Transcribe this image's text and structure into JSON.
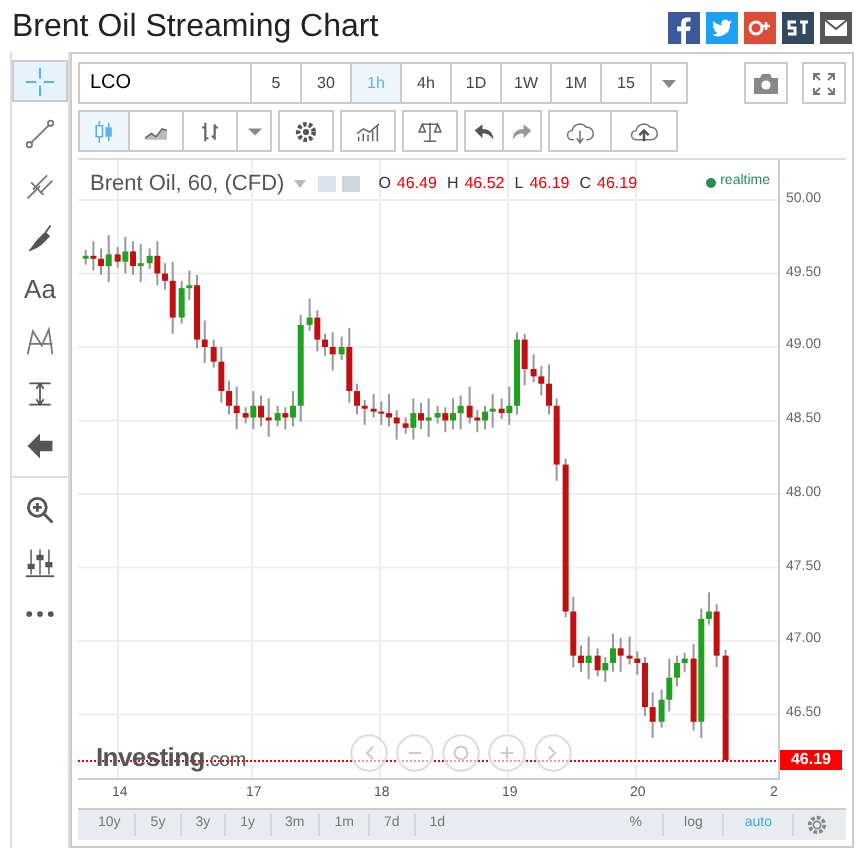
{
  "title": "Brent Oil Streaming Chart",
  "left_tools": [
    {
      "kind": "crosshair",
      "selected": true
    },
    {
      "kind": "line",
      "selected": false
    },
    {
      "kind": "fork",
      "selected": false
    },
    {
      "kind": "brush",
      "selected": false
    },
    {
      "kind": "text",
      "label": "Aa",
      "selected": false
    },
    {
      "kind": "pattern",
      "selected": false
    },
    {
      "kind": "measure",
      "selected": false
    },
    {
      "kind": "back",
      "selected": false
    },
    {
      "kind": "zoom",
      "selected": false
    },
    {
      "kind": "adjust",
      "selected": false
    },
    {
      "kind": "more",
      "selected": false
    }
  ],
  "symbol": "LCO",
  "intervals": [
    {
      "label": "5",
      "selected": false
    },
    {
      "label": "30",
      "selected": false
    },
    {
      "label": "1h",
      "selected": true
    },
    {
      "label": "4h",
      "selected": false
    },
    {
      "label": "1D",
      "selected": false
    },
    {
      "label": "1W",
      "selected": false
    },
    {
      "label": "1M",
      "selected": false
    },
    {
      "label": "15",
      "selected": false
    }
  ],
  "chart_tools": [
    {
      "kind": "candles",
      "selected": true
    },
    {
      "kind": "line",
      "selected": false
    },
    {
      "kind": "bars",
      "selected": false
    },
    {
      "kind": "caret",
      "selected": false
    },
    {
      "kind": "settings",
      "selected": false
    },
    {
      "kind": "indicators",
      "selected": false
    },
    {
      "kind": "compare",
      "selected": false
    },
    {
      "kind": "undo",
      "selected": false
    },
    {
      "kind": "redo",
      "selected": false
    },
    {
      "kind": "download",
      "selected": false
    },
    {
      "kind": "upload",
      "selected": false
    }
  ],
  "legend": {
    "name": "Brent Oil, 60, (CFD)",
    "values": [
      {
        "key": "O",
        "value": "46.49"
      },
      {
        "key": "H",
        "value": "46.52"
      },
      {
        "key": "L",
        "value": "46.19"
      },
      {
        "key": "C",
        "value": "46.19"
      }
    ],
    "status": "realtime"
  },
  "chart_data": {
    "type": "candlestick",
    "x": [
      15.7,
      15.76,
      15.82,
      15.88,
      15.95,
      16.01,
      16.07,
      16.13,
      16.2,
      16.26,
      16.32,
      16.38,
      16.45,
      16.51,
      16.57,
      16.63,
      16.7,
      16.76,
      16.82,
      16.88,
      16.95,
      17.01,
      17.07,
      17.13,
      17.2,
      17.26,
      17.32,
      17.38,
      17.45,
      17.51,
      17.57,
      17.63,
      17.7,
      17.76,
      17.82,
      17.88,
      17.95,
      18.01,
      18.07,
      18.13,
      18.2,
      18.26,
      18.32,
      18.38,
      18.45,
      18.51,
      18.57,
      18.63,
      18.7,
      18.76,
      18.82,
      18.88,
      18.95,
      19.01,
      19.07,
      19.13,
      19.2,
      19.26,
      19.32,
      19.38,
      19.45,
      19.51,
      19.57,
      19.63,
      19.7,
      19.76,
      19.82,
      19.88,
      19.95,
      20.01,
      20.07,
      20.13,
      20.2,
      20.26,
      20.32,
      20.38,
      20.45,
      20.51,
      20.57,
      20.63,
      20.7
    ],
    "ohlc": [
      [
        49.6,
        49.66,
        49.56,
        49.62
      ],
      [
        49.62,
        49.72,
        49.52,
        49.6
      ],
      [
        49.6,
        49.67,
        49.49,
        49.55
      ],
      [
        49.55,
        49.76,
        49.44,
        49.63
      ],
      [
        49.63,
        49.68,
        49.54,
        49.58
      ],
      [
        49.58,
        49.75,
        49.5,
        49.65
      ],
      [
        49.65,
        49.72,
        49.49,
        49.55
      ],
      [
        49.55,
        49.7,
        49.44,
        49.57
      ],
      [
        49.57,
        49.67,
        49.53,
        49.62
      ],
      [
        49.62,
        49.72,
        49.42,
        49.5
      ],
      [
        49.5,
        49.57,
        49.39,
        49.45
      ],
      [
        49.45,
        49.58,
        49.09,
        49.2
      ],
      [
        49.2,
        49.45,
        49.16,
        49.4
      ],
      [
        49.4,
        49.52,
        49.32,
        49.42
      ],
      [
        49.42,
        49.49,
        48.99,
        49.05
      ],
      [
        49.05,
        49.18,
        48.89,
        49.0
      ],
      [
        49.0,
        49.05,
        48.86,
        48.9
      ],
      [
        48.9,
        49.0,
        48.62,
        48.7
      ],
      [
        48.7,
        48.77,
        48.54,
        48.6
      ],
      [
        48.6,
        48.73,
        48.44,
        48.55
      ],
      [
        48.55,
        48.59,
        48.48,
        48.52
      ],
      [
        48.52,
        48.7,
        48.44,
        48.6
      ],
      [
        48.6,
        48.67,
        48.46,
        48.52
      ],
      [
        48.52,
        48.65,
        48.39,
        48.5
      ],
      [
        48.5,
        48.6,
        48.46,
        48.55
      ],
      [
        48.55,
        48.59,
        48.44,
        48.52
      ],
      [
        48.52,
        48.7,
        48.46,
        48.6
      ],
      [
        48.6,
        49.22,
        48.49,
        49.15
      ],
      [
        49.15,
        49.33,
        49.11,
        49.2
      ],
      [
        49.2,
        49.25,
        48.97,
        49.05
      ],
      [
        49.05,
        49.09,
        48.94,
        49.0
      ],
      [
        49.0,
        49.1,
        48.84,
        48.95
      ],
      [
        48.95,
        49.07,
        48.91,
        49.0
      ],
      [
        49.0,
        49.13,
        48.62,
        48.7
      ],
      [
        48.7,
        48.75,
        48.54,
        48.6
      ],
      [
        48.6,
        48.64,
        48.47,
        48.58
      ],
      [
        48.58,
        48.68,
        48.52,
        48.56
      ],
      [
        48.56,
        48.63,
        48.47,
        48.55
      ],
      [
        48.55,
        48.68,
        48.46,
        48.52
      ],
      [
        48.52,
        48.57,
        48.37,
        48.48
      ],
      [
        48.48,
        48.52,
        48.41,
        48.45
      ],
      [
        48.45,
        48.65,
        48.37,
        48.55
      ],
      [
        48.55,
        48.62,
        48.44,
        48.5
      ],
      [
        48.5,
        48.65,
        48.39,
        48.52
      ],
      [
        48.52,
        48.6,
        48.48,
        48.55
      ],
      [
        48.55,
        48.59,
        48.42,
        48.5
      ],
      [
        48.5,
        48.65,
        48.44,
        48.55
      ],
      [
        48.55,
        48.67,
        48.44,
        48.6
      ],
      [
        48.6,
        48.73,
        48.48,
        48.52
      ],
      [
        48.52,
        48.57,
        48.42,
        48.5
      ],
      [
        48.5,
        48.6,
        48.44,
        48.56
      ],
      [
        48.56,
        48.68,
        48.45,
        48.58
      ],
      [
        48.58,
        48.65,
        48.51,
        48.55
      ],
      [
        48.55,
        48.73,
        48.47,
        48.6
      ],
      [
        48.6,
        49.1,
        48.54,
        49.05
      ],
      [
        49.05,
        49.09,
        48.74,
        48.85
      ],
      [
        48.85,
        48.95,
        48.76,
        48.8
      ],
      [
        48.8,
        48.87,
        48.67,
        48.75
      ],
      [
        48.75,
        48.88,
        48.54,
        48.6
      ],
      [
        48.6,
        48.65,
        48.09,
        48.2
      ],
      [
        48.2,
        48.24,
        47.16,
        47.2
      ],
      [
        47.2,
        47.3,
        46.82,
        46.9
      ],
      [
        46.9,
        46.97,
        46.79,
        46.85
      ],
      [
        46.85,
        47.03,
        46.74,
        46.9
      ],
      [
        46.9,
        46.95,
        46.76,
        46.8
      ],
      [
        46.8,
        46.89,
        46.72,
        46.85
      ],
      [
        46.85,
        47.05,
        46.79,
        46.95
      ],
      [
        46.95,
        47.02,
        46.79,
        46.9
      ],
      [
        46.9,
        47.03,
        46.84,
        46.88
      ],
      [
        46.88,
        46.93,
        46.77,
        46.85
      ],
      [
        46.85,
        46.89,
        46.49,
        46.55
      ],
      [
        46.55,
        46.65,
        46.34,
        46.45
      ],
      [
        46.45,
        46.67,
        46.41,
        46.6
      ],
      [
        46.6,
        46.88,
        46.52,
        46.75
      ],
      [
        46.75,
        46.9,
        46.69,
        46.85
      ],
      [
        46.85,
        46.92,
        46.79,
        46.88
      ],
      [
        46.88,
        46.98,
        46.39,
        46.45
      ],
      [
        46.45,
        47.22,
        46.34,
        47.15
      ],
      [
        47.15,
        47.33,
        47.11,
        47.2
      ],
      [
        47.2,
        47.25,
        46.82,
        46.9
      ],
      [
        46.9,
        46.94,
        46.19,
        46.19
      ]
    ],
    "xlim": [
      15.64,
      21.125
    ],
    "ylim": [
      46.054,
      50.272
    ],
    "grid": true,
    "ref_lines": [
      {
        "axis": "y",
        "value": 46.19,
        "label": "46.19"
      }
    ],
    "xticks": [
      {
        "value": 17,
        "label": "17"
      },
      {
        "value": 18,
        "label": "18"
      },
      {
        "value": 19,
        "label": "19"
      },
      {
        "value": 20,
        "label": "20"
      }
    ],
    "yticks": [
      {
        "value": 50,
        "label": "50.00"
      },
      {
        "value": 49.5,
        "label": "49.50"
      },
      {
        "value": 49,
        "label": "49.00"
      },
      {
        "value": 48.5,
        "label": "48.50"
      },
      {
        "value": 48,
        "label": "48.00"
      },
      {
        "value": 47.5,
        "label": "47.50"
      },
      {
        "value": 47,
        "label": "47.00"
      },
      {
        "value": 46.5,
        "label": "46.50"
      }
    ]
  },
  "date_axis_edge_labels": [
    {
      "kind": "start",
      "label": "14"
    },
    {
      "kind": "end",
      "label": "2"
    }
  ],
  "logo": {
    "name": "Investing",
    "suffix": ".com"
  },
  "ranges": [
    "10y",
    "5y",
    "3y",
    "1y",
    "3m",
    "1m",
    "7d",
    "1d"
  ],
  "scales": [
    {
      "label": "%",
      "selected": false
    },
    {
      "label": "log",
      "selected": false
    },
    {
      "label": "auto",
      "selected": true
    }
  ]
}
